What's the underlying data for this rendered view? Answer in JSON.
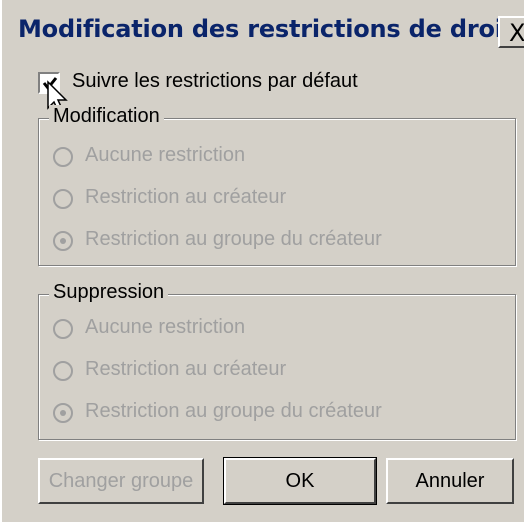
{
  "window": {
    "title": "Modification des restrictions de droit",
    "close_glyph": "X"
  },
  "follow_defaults": {
    "label": "Suivre les restrictions par défaut",
    "checked": true
  },
  "modification_group": {
    "label": "Modification",
    "options": [
      {
        "label": "Aucune restriction",
        "selected": false
      },
      {
        "label": "Restriction au créateur",
        "selected": false
      },
      {
        "label": "Restriction au groupe du créateur",
        "selected": true
      }
    ]
  },
  "suppression_group": {
    "label": "Suppression",
    "options": [
      {
        "label": "Aucune restriction",
        "selected": false
      },
      {
        "label": "Restriction au créateur",
        "selected": false
      },
      {
        "label": "Restriction au groupe du créateur",
        "selected": true
      }
    ]
  },
  "buttons": {
    "change_group": "Changer groupe",
    "ok": "OK",
    "cancel": "Annuler"
  },
  "colors": {
    "face": "#d4d0c8",
    "title_text": "#0a246a",
    "disabled_text": "#a0a0a0"
  }
}
